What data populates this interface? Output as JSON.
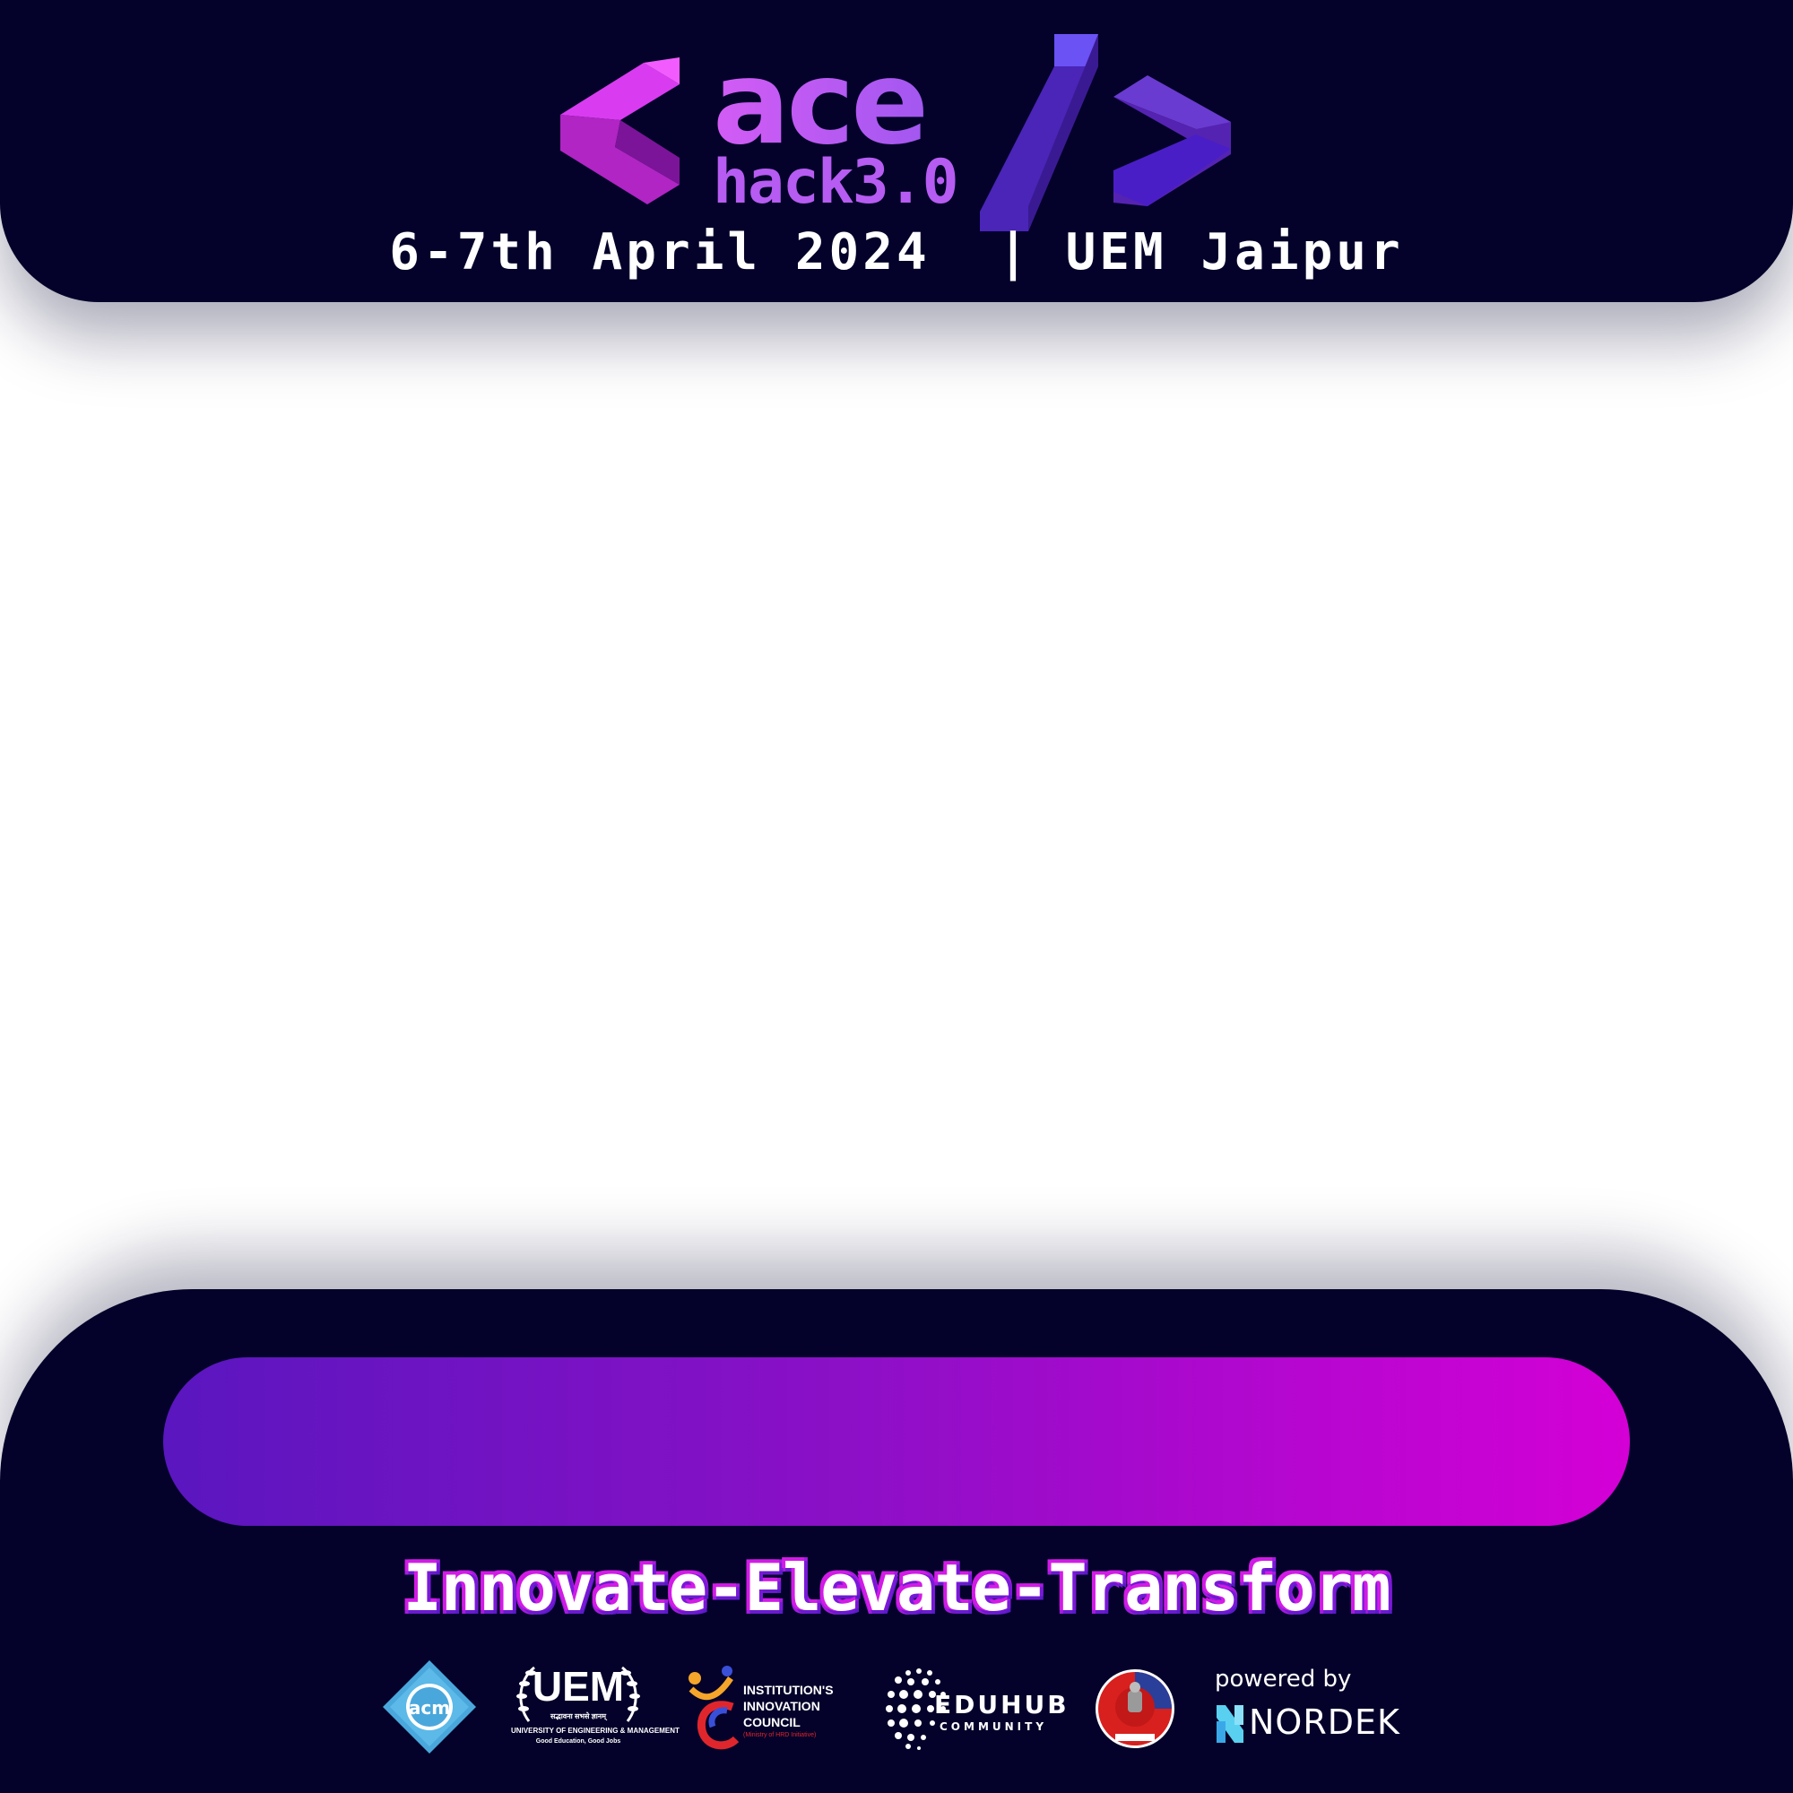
{
  "header": {
    "logo_ace": "ace",
    "logo_hack": "hack3.0",
    "event_date": "6-7th April 2024",
    "separator": "|",
    "event_venue": "UEM Jaipur"
  },
  "footer": {
    "tagline": "Innovate-Elevate-Transform",
    "sponsors": {
      "acm": "acm",
      "uem": "UEM",
      "uem_hindi": "सद्भावना सभसे ज्ञानम्",
      "uem_full": "UNIVERSITY OF ENGINEERING & MANAGEMENT",
      "uem_motto": "Good Education, Good Jobs",
      "iic_line1": "INSTITUTION'S",
      "iic_line2": "INNOVATION",
      "iic_line3": "COUNCIL",
      "iic_sub": "(Ministry of HRD Initiative)",
      "eduhub": "EDUHUB",
      "eduhub_sub": "COMMUNITY",
      "powered_by": "powered by",
      "nordek": "NORDEK"
    }
  },
  "colors": {
    "panel_bg": "#04022a",
    "accent_pink": "#d400d6",
    "accent_violet": "#5a16bf",
    "logo_purple": "#b65cf2"
  },
  "icons": [
    "bracket-left-icon",
    "slash-icon",
    "bracket-right-icon",
    "acm-logo",
    "uem-logo",
    "iic-logo",
    "eduhub-logo",
    "police-emblem-logo",
    "nordek-logo"
  ]
}
